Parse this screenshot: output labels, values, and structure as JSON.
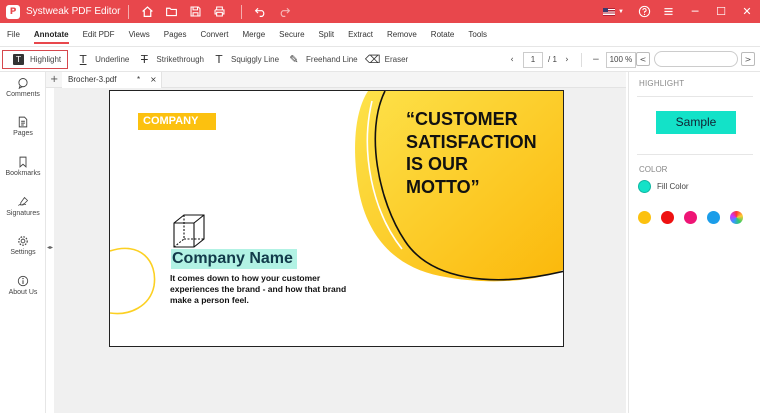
{
  "app": {
    "title": "Systweak PDF Editor",
    "logo_letter": "P"
  },
  "menu": [
    "File",
    "Annotate",
    "Edit PDF",
    "Views",
    "Pages",
    "Convert",
    "Merge",
    "Secure",
    "Split",
    "Extract",
    "Remove",
    "Rotate",
    "Tools"
  ],
  "menu_active": "Annotate",
  "tools": [
    {
      "label": "Highlight",
      "icon": "T"
    },
    {
      "label": "Underline",
      "icon": "T"
    },
    {
      "label": "Strikethrough",
      "icon": "T"
    },
    {
      "label": "Squiggly Line",
      "icon": "T"
    },
    {
      "label": "Freehand Line",
      "icon": "pen"
    },
    {
      "label": "Eraser",
      "icon": "eraser"
    }
  ],
  "pager": {
    "current": "1",
    "total": "/ 1",
    "zoom": "100 %"
  },
  "sidebar": [
    {
      "label": "Comments",
      "icon": "comments-icon"
    },
    {
      "label": "Pages",
      "icon": "pages-icon"
    },
    {
      "label": "Bookmarks",
      "icon": "bookmark-icon"
    },
    {
      "label": "Signatures",
      "icon": "signature-icon"
    },
    {
      "label": "Settings",
      "icon": "gear-icon"
    },
    {
      "label": "About Us",
      "icon": "info-icon"
    }
  ],
  "tab": {
    "name": "Brocher-3.pdf",
    "modified": "*",
    "close": "×",
    "new": "+"
  },
  "document": {
    "company_badge": "COMPANY",
    "company_name": "Company Name",
    "description": [
      "It comes down to how your customer",
      "experiences the brand - and how that brand",
      "make a person feel."
    ],
    "quote": [
      "“CUSTOMER",
      "SATISFACTION",
      "IS OUR",
      "MOTTO”"
    ]
  },
  "panel": {
    "highlight_header": "HIGHLIGHT",
    "sample": "Sample",
    "color_header": "COLOR",
    "fill_label": "Fill Color",
    "fill_color": "#13e2c8",
    "swatches": [
      "#fcc10f",
      "#ee1111",
      "#ee1575",
      "#1b9de9",
      "multicolor"
    ]
  },
  "colors": {
    "brand": "#e8474c",
    "accent_yellow": "#fcc10f",
    "highlight": "#13e2c8"
  }
}
